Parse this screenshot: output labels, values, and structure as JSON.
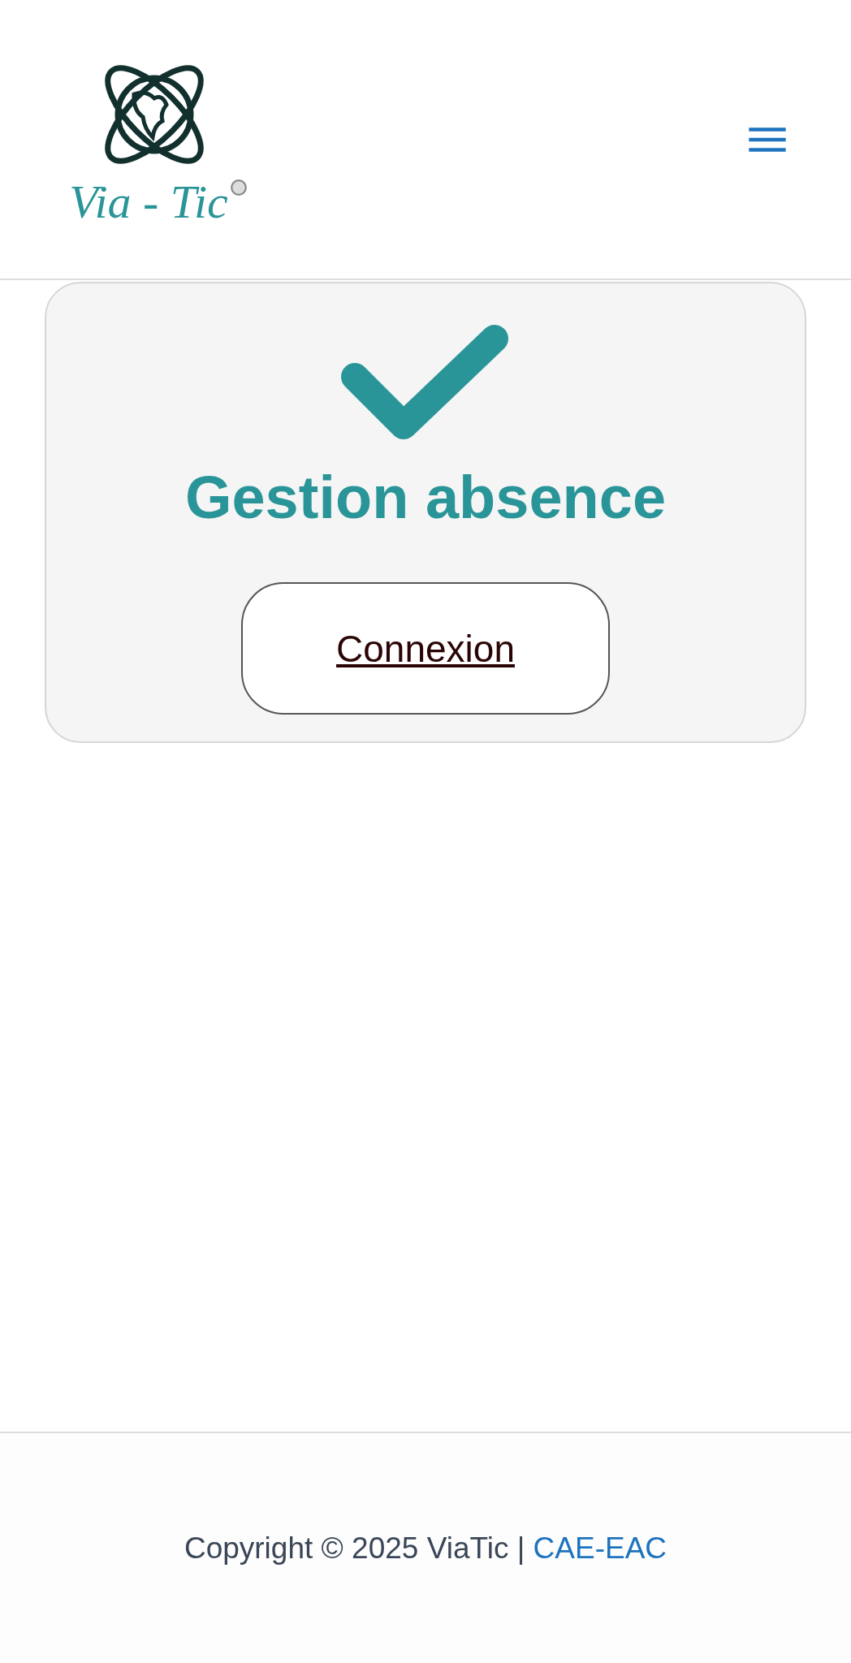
{
  "header": {
    "logo_text": "Via - Tic"
  },
  "card": {
    "title": "Gestion absence",
    "button": "Connexion"
  },
  "footer": {
    "copyright": "Copyright © 2025 ViaTic |",
    "link": "CAE-EAC"
  }
}
